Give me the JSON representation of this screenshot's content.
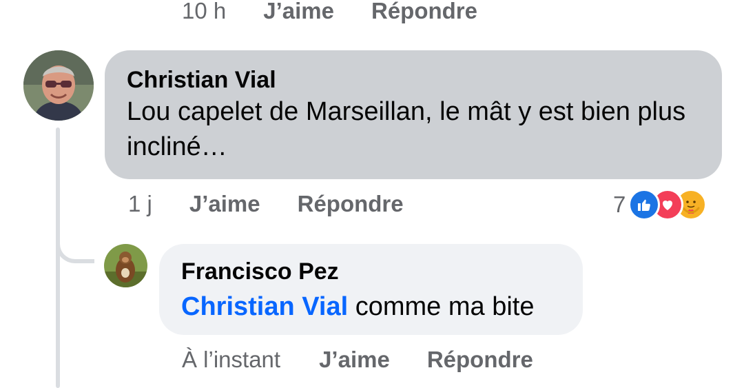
{
  "top_meta": {
    "time": "10 h",
    "like": "J’aime",
    "reply": "Répondre"
  },
  "comment": {
    "author": "Christian Vial",
    "text": "Lou capelet de Marseillan, le mât y est bien plus incliné…",
    "time": "1 j",
    "like": "J’aime",
    "reply": "Répondre",
    "reaction_count": "7",
    "reactions": [
      "like-icon",
      "love-icon",
      "care-icon"
    ]
  },
  "reply": {
    "author": "Francisco Pez",
    "mention": "Christian Vial",
    "text": "comme ma bite",
    "time": "À l’instant",
    "like": "J’aime",
    "reply": "Répondre"
  },
  "colors": {
    "bubble_main": "#cdd0d4",
    "bubble_reply": "#f0f2f5",
    "mention": "#0866ff",
    "meta": "#65676b",
    "like": "#1b74e4",
    "love": "#f33e58",
    "care": "#f7b125"
  }
}
